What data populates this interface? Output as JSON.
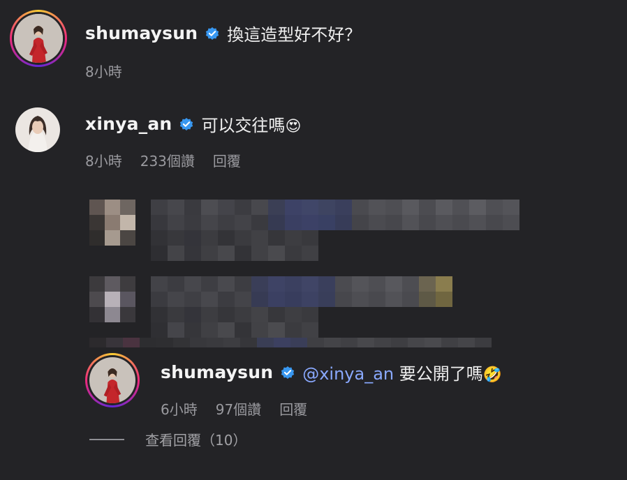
{
  "comments": [
    {
      "username": "shumaysun",
      "text": "換這造型好不好？",
      "time": "8小時"
    },
    {
      "username": "xinya_an",
      "text": "可以交往嗎",
      "emoji": "😍",
      "time": "8小時",
      "likes": "233個讚",
      "reply": "回覆"
    }
  ],
  "reply": {
    "username": "shumaysun",
    "mention": "@xinya_an",
    "text": "要公開了嗎",
    "emoji": "🤣",
    "time": "6小時",
    "likes": "97個讚",
    "reply": "回覆"
  },
  "view_replies": "查看回覆（10）",
  "colors": {
    "background": "#232326",
    "verified": "#3897f0",
    "mention": "#8aa9ff",
    "meta": "#9a9a9f"
  }
}
